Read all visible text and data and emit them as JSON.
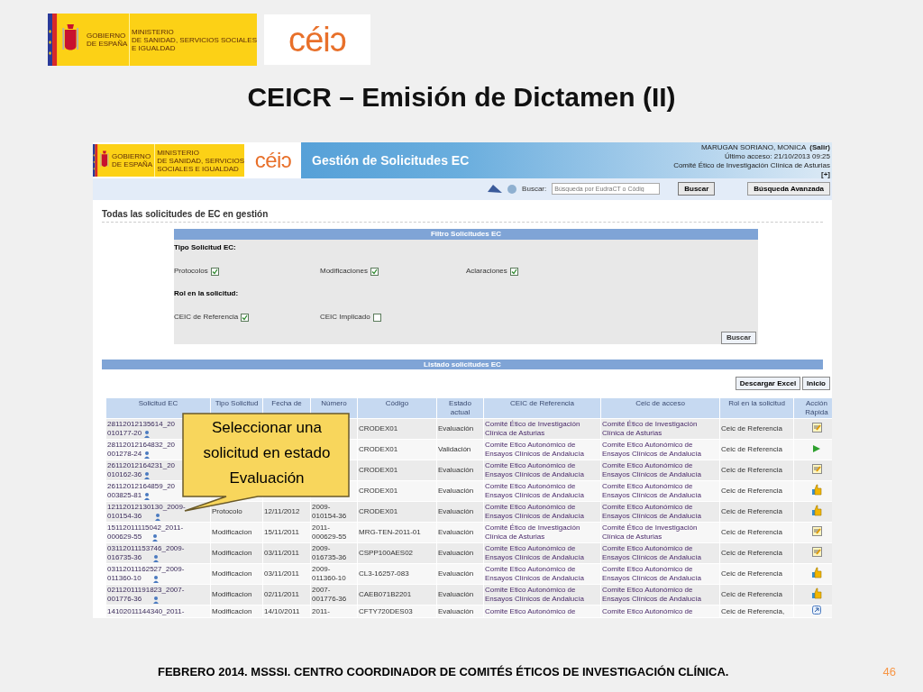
{
  "slide": {
    "logo_texts": [
      "GOBIERNO\nDE ESPAÑA",
      "MINISTERIO\nDE SANIDAD, SERVICIOS SOCIALES\nE IGUALDAD"
    ],
    "ceic_logo": "céiɔ",
    "app_logo_texts": [
      "GOBIERNO\nDE ESPAÑA",
      "MINISTERIO\nDE SANIDAD, SERVICIOS\nSOCIALES E IGUALDAD"
    ],
    "app_ceic_logo": "céiɔ",
    "title": "CEICR – Emisión de Dictamen (II)",
    "footer": "FEBRERO 2014. MSSSI. CENTRO COORDINADOR DE COMITÉS ÉTICOS DE INVESTIGACIÓN CLÍNICA.",
    "page": "46"
  },
  "app": {
    "header_title": "Gestión de Solicitudes EC",
    "user": "MARUGAN SORIANO, MONICA",
    "logout": "(Salir)",
    "last_access": "Último acceso: 21/10/2013 09:25",
    "committee": "Comité Ético de Investigación Clínica de Asturias",
    "expand": "[+]",
    "search_label": "Buscar:",
    "search_placeholder": "Búsqueda por EudraCT o Códig",
    "search_button": "Buscar",
    "advanced_button": "Búsqueda Avanzada",
    "heading": "Todas las solicitudes de EC en gestión"
  },
  "filter": {
    "title": "Filtro Solicitudes EC",
    "groups": [
      {
        "label": "Tipo Solicitud EC:",
        "options": [
          {
            "label": "Protocolos",
            "checked": true
          },
          {
            "label": "Modificaciones",
            "checked": true
          },
          {
            "label": "Aclaraciones",
            "checked": true
          }
        ]
      },
      {
        "label": "Rol en la solicitud:",
        "options": [
          {
            "label": "CEIC de Referencia",
            "checked": true
          },
          {
            "label": "CEIC Implicado",
            "checked": false
          }
        ]
      }
    ],
    "button": "Buscar"
  },
  "list": {
    "title": "Listado solicitudes EC",
    "buttons": [
      "Descargar Excel",
      "Inicio"
    ],
    "columns": [
      "Solicitud EC",
      "Tipo Solicitud",
      "Fecha de",
      "Número",
      "Código",
      "Estado\nactual",
      "CEIC de Referencia",
      "Ceic de acceso",
      "Rol en la solicitud",
      "Acción\nRápida"
    ],
    "rows": [
      {
        "cells": [
          "28112012135614_20\n010177-20",
          null,
          null,
          null,
          "CRODEX01",
          "Evaluación",
          "Comité Ético de Investigación\nClínica de Asturias",
          "Comité Ético de Investigación\nClínica de Asturias",
          "Ceic de Referencia"
        ],
        "action_icon": {
          "kind": "note"
        }
      },
      {
        "cells": [
          "28112012164832_20\n001278-24",
          null,
          null,
          null,
          "CRODEX01",
          "Validación",
          "Comite Etico Autonómico de\nEnsayos Clínicos de Andalucía",
          "Comite Etico Autonómico de\nEnsayos Clínicos de Andalucía",
          "Ceic de Referencia"
        ],
        "action_icon": {
          "kind": "play"
        }
      },
      {
        "cells": [
          "26112012164231_20\n010162-36",
          null,
          null,
          null,
          "CRODEX01",
          "Evaluación",
          "Comite Etico Autonómico de\nEnsayos Clínicos de Andalucía",
          "Comite Etico Autonómico de\nEnsayos Clínicos de Andalucía",
          "Ceic de Referencia"
        ],
        "action_icon": {
          "kind": "note"
        }
      },
      {
        "cells": [
          "26112012164859_20\n003825-81",
          null,
          null,
          null,
          "CRODEX01",
          "Evaluación",
          "Comite Etico Autonómico de\nEnsayos Clínicos de Andalucía",
          "Comite Etico Autonómico de\nEnsayos Clínicos de Andalucía",
          "Ceic de Referencia"
        ],
        "action_icon": {
          "kind": "thumb"
        }
      },
      {
        "cells": [
          "12112012130130_2009-\n010154-36",
          "Protocolo",
          "12/11/2012",
          "2009-\n010154-36",
          "CRODEX01",
          "Evaluación",
          "Comite Etico Autonómico de\nEnsayos Clínicos de Andalucía",
          "Comite Etico Autonómico de\nEnsayos Clínicos de Andalucía",
          "Ceic de Referencia"
        ],
        "action_icon": {
          "kind": "thumb"
        }
      },
      {
        "cells": [
          "15112011115042_2011-\n000629-55",
          "Modificacion",
          "15/11/2011",
          "2011-\n000629-55",
          "MRG-TEN-2011-01",
          "Evaluación",
          "Comité Ético de Investigación\nClínica de Asturias",
          "Comité Ético de Investigación\nClínica de Asturias",
          "Ceic de Referencia"
        ],
        "action_icon": {
          "kind": "note"
        }
      },
      {
        "cells": [
          "03112011153746_2009-\n016735-36",
          "Modificacion",
          "03/11/2011",
          "2009-\n016735-36",
          "CSPP100AES02",
          "Evaluación",
          "Comite Etico Autonómico de\nEnsayos Clínicos de Andalucía",
          "Comite Etico Autonómico de\nEnsayos Clínicos de Andalucía",
          "Ceic de Referencia"
        ],
        "action_icon": {
          "kind": "note"
        }
      },
      {
        "cells": [
          "03112011162527_2009-\n011360-10",
          "Modificacion",
          "03/11/2011",
          "2009-\n011360-10",
          "CL3-16257-083",
          "Evaluación",
          "Comite Etico Autonómico de\nEnsayos Clínicos de Andalucía",
          "Comite Etico Autonómico de\nEnsayos Clínicos de Andalucía",
          "Ceic de Referencia"
        ],
        "action_icon": {
          "kind": "thumb"
        }
      },
      {
        "cells": [
          "02112011191823_2007-\n001776-36",
          "Modificacion",
          "02/11/2011",
          "2007-\n001776-36",
          "CAEB071B2201",
          "Evaluación",
          "Comite Etico Autonómico de\nEnsayos Clínicos de Andalucía",
          "Comite Etico Autonómico de\nEnsayos Clínicos de Andalucía",
          "Ceic de Referencia"
        ],
        "action_icon": {
          "kind": "thumb"
        }
      },
      {
        "cells": [
          "14102011144340_2011-",
          "Modificacion",
          "14/10/2011",
          "2011-",
          "CFTY720DES03",
          "Evaluación",
          "Comite Etico Autonómico de",
          "Comite Etico Autonómico de",
          "Ceic de Referencia,"
        ],
        "action_icon": {
          "kind": "arrow"
        }
      }
    ]
  },
  "callout": "Seleccionar una solicitud en estado Evaluación"
}
